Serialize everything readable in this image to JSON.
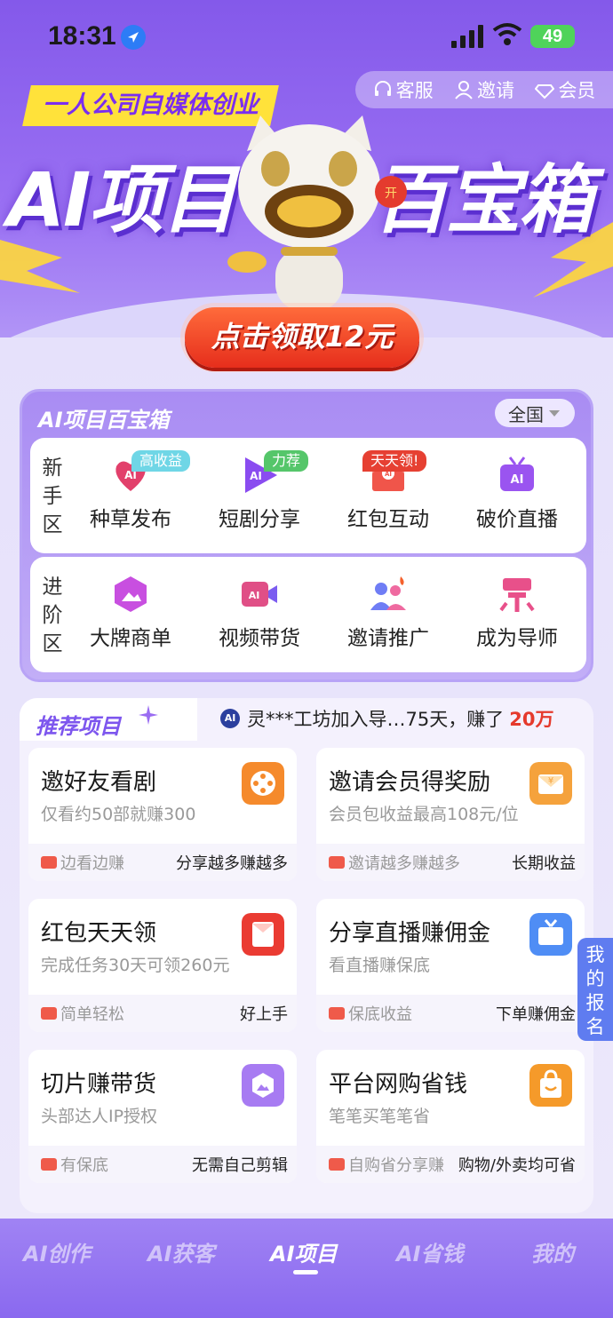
{
  "status_bar": {
    "time": "18:31",
    "battery": "49"
  },
  "top_actions": [
    {
      "label": "客服",
      "icon": "headset-icon"
    },
    {
      "label": "邀请",
      "icon": "user-icon"
    },
    {
      "label": "会员",
      "icon": "diamond-icon"
    }
  ],
  "hero": {
    "slogan": "一人公司自媒体创业",
    "title_left": "AI项目",
    "title_right": "百宝箱",
    "claim_button": "点击领取12元",
    "coin_label": "开"
  },
  "treasure_box": {
    "title": "AI项目百宝箱",
    "region": "全国",
    "zones": [
      {
        "label": "新手区",
        "items": [
          {
            "label": "种草发布",
            "tag": "高收益",
            "tag_color": "#6fd6e6",
            "icon": "heart-ai-icon",
            "color": "#e2406b"
          },
          {
            "label": "短剧分享",
            "tag": "力荐",
            "tag_color": "#55c66a",
            "icon": "play-ai-icon",
            "color": "#8a4cf0"
          },
          {
            "label": "红包互动",
            "tag": "天天领!",
            "tag_color": "#e64032",
            "icon": "red-envelope-icon",
            "color": "#f0554a"
          },
          {
            "label": "破价直播",
            "tag": "",
            "tag_color": "",
            "icon": "tv-ai-icon",
            "color": "#9a54f0"
          }
        ]
      },
      {
        "label": "进阶区",
        "items": [
          {
            "label": "大牌商单",
            "tag": "",
            "icon": "image-hex-icon",
            "color": "#c84fe0"
          },
          {
            "label": "视频带货",
            "tag": "",
            "icon": "video-ai-icon",
            "color": "#e04f86"
          },
          {
            "label": "邀请推广",
            "tag": "",
            "icon": "people-fire-icon",
            "color": "#6f7df5"
          },
          {
            "label": "成为导师",
            "tag": "",
            "icon": "mentor-icon",
            "color": "#e8508a"
          }
        ]
      }
    ]
  },
  "recommend": {
    "title": "推荐项目",
    "ticker": {
      "badge": "AI",
      "text": "灵***工坊加入导…75天，赚了",
      "amount": "20万"
    },
    "cards": [
      {
        "title": "邀好友看剧",
        "sub": "仅看约50部就赚300",
        "foot_left": "边看边赚",
        "foot_right": "分享越多赚越多",
        "icon": "film-reel-icon",
        "color": "#f58a2c"
      },
      {
        "title": "邀请会员得奖励",
        "sub": "会员包收益最高108元/位",
        "foot_left": "邀请越多赚越多",
        "foot_right": "长期收益",
        "icon": "envelope-yen-icon",
        "color": "#f5a23c"
      },
      {
        "title": "红包天天领",
        "sub": "完成任务30天可领260元",
        "foot_left": "简单轻松",
        "foot_right": "好上手",
        "icon": "red-packet-icon",
        "color": "#ea3b32"
      },
      {
        "title": "分享直播赚佣金",
        "sub": "看直播赚保底",
        "foot_left": "保底收益",
        "foot_right": "下单赚佣金",
        "icon": "live-tv-icon",
        "color": "#4f8df5"
      },
      {
        "title": "切片赚带货",
        "sub": "头部达人IP授权",
        "foot_left": "有保底",
        "foot_right": "无需自己剪辑",
        "icon": "clip-icon",
        "color": "#a77bf2"
      },
      {
        "title": "平台网购省钱",
        "sub": "笔笔买笔笔省",
        "foot_left": "自购省分享赚",
        "foot_right": "购物/外卖均可省",
        "icon": "shopping-bag-icon",
        "color": "#f59a2a"
      }
    ]
  },
  "signup_tab": "我的报名",
  "tabs": [
    {
      "label": "AI创作",
      "active": false
    },
    {
      "label": "AI获客",
      "active": false
    },
    {
      "label": "AI项目",
      "active": true
    },
    {
      "label": "AI省钱",
      "active": false
    },
    {
      "label": "我的",
      "active": false
    }
  ]
}
